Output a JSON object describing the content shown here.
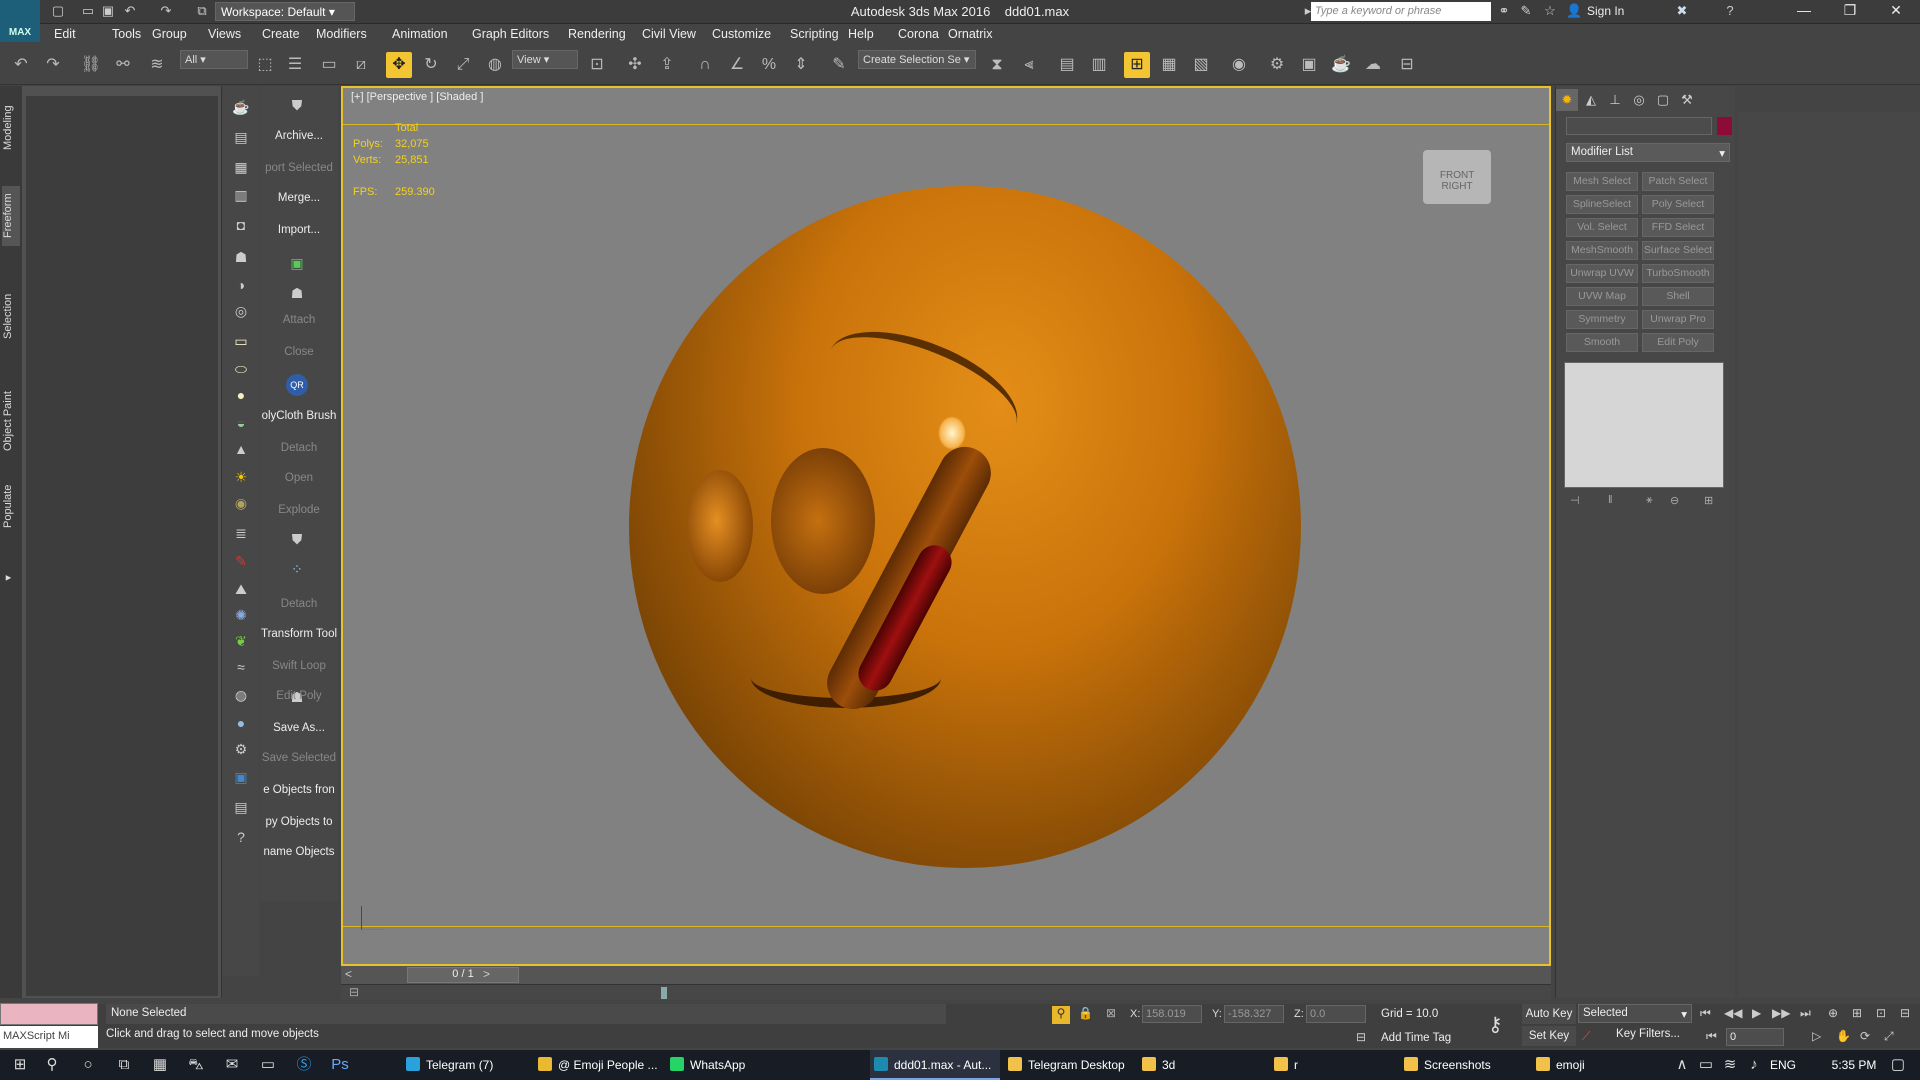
{
  "window": {
    "title": "Autodesk 3ds Max 2016",
    "file": "ddd01.max",
    "workspace": "Workspace: Default",
    "logo": "MAX",
    "search_placeholder": "Type a keyword or phrase",
    "signin": "Sign In"
  },
  "menu": [
    "Edit",
    "Tools",
    "Group",
    "Views",
    "Create",
    "Modifiers",
    "Animation",
    "Graph Editors",
    "Rendering",
    "Civil View",
    "Customize",
    "Scripting",
    "Help",
    "Corona",
    "Ornatrix"
  ],
  "toolbar": {
    "filter": "All",
    "ref_coord": "View",
    "selection_set_placeholder": "Create Selection Se"
  },
  "ribbon_tabs": [
    "Modeling",
    "Freeform",
    "Selection",
    "Object Paint",
    "Populate"
  ],
  "tool_labels": [
    {
      "text": "Archive...",
      "dim": false
    },
    {
      "text": "port Selected",
      "dim": true
    },
    {
      "text": "Merge...",
      "dim": false
    },
    {
      "text": "Import...",
      "dim": false
    },
    {
      "text": "Attach",
      "dim": true
    },
    {
      "text": "Close",
      "dim": true
    },
    {
      "text": "olyCloth Brush",
      "dim": false
    },
    {
      "text": "Detach",
      "dim": true
    },
    {
      "text": "Open",
      "dim": true
    },
    {
      "text": "Explode",
      "dim": true
    },
    {
      "text": "Detach",
      "dim": true
    },
    {
      "text": "Transform Tool",
      "dim": false
    },
    {
      "text": "Swift Loop",
      "dim": true
    },
    {
      "text": "Edit Poly",
      "dim": true
    },
    {
      "text": "Save As...",
      "dim": false
    },
    {
      "text": "Save Selected",
      "dim": true
    },
    {
      "text": "e Objects fron",
      "dim": false
    },
    {
      "text": "py Objects to",
      "dim": false
    },
    {
      "text": "name Objects",
      "dim": false
    }
  ],
  "viewport": {
    "label": "[+] [Perspective ] [Shaded ]",
    "stats_header": "Total",
    "polys_label": "Polys:",
    "polys": "32,075",
    "verts_label": "Verts:",
    "verts": "25,851",
    "fps_label": "FPS:",
    "fps": "259.390",
    "viewcube_front": "FRONT",
    "viewcube_right": "RIGHT"
  },
  "timeline": {
    "counter": "0 / 1"
  },
  "command_panel": {
    "modifier_list": "Modifier List",
    "color": "#8c0b37",
    "modifiers": [
      "Mesh Select",
      "Patch Select",
      "SplineSelect",
      "Poly Select",
      "Vol. Select",
      "FFD Select",
      "MeshSmooth",
      "Surface Select",
      "Unwrap UVW",
      "TurboSmooth",
      "UVW Map",
      "Shell",
      "Symmetry",
      "Unwrap Pro",
      "Smooth",
      "Edit Poly"
    ]
  },
  "status": {
    "maxscript": "MAXScript Mi",
    "selection": "None Selected",
    "prompt": "Click and drag to select and move objects",
    "x_label": "X:",
    "x": "158.019",
    "y_label": "Y:",
    "y": "-158.327",
    "z_label": "Z:",
    "z": "0.0",
    "grid": "Grid = 10.0",
    "add_time_tag": "Add Time Tag",
    "auto_key": "Auto Key",
    "set_key": "Set Key",
    "key_mode": "Selected",
    "key_filters": "Key Filters...",
    "frame": "0"
  },
  "taskbar": {
    "apps": [
      {
        "label": "Telegram (7)",
        "active": false
      },
      {
        "label": "@ Emoji People ...",
        "active": false
      },
      {
        "label": "WhatsApp",
        "active": false
      },
      {
        "label": "ddd01.max - Aut...",
        "active": true
      },
      {
        "label": "Telegram Desktop",
        "active": false
      },
      {
        "label": "3d",
        "active": false
      },
      {
        "label": "r",
        "active": false
      },
      {
        "label": "Screenshots",
        "active": false
      },
      {
        "label": "emoji",
        "active": false
      }
    ],
    "lang": "ENG",
    "time": "5:35 PM"
  }
}
